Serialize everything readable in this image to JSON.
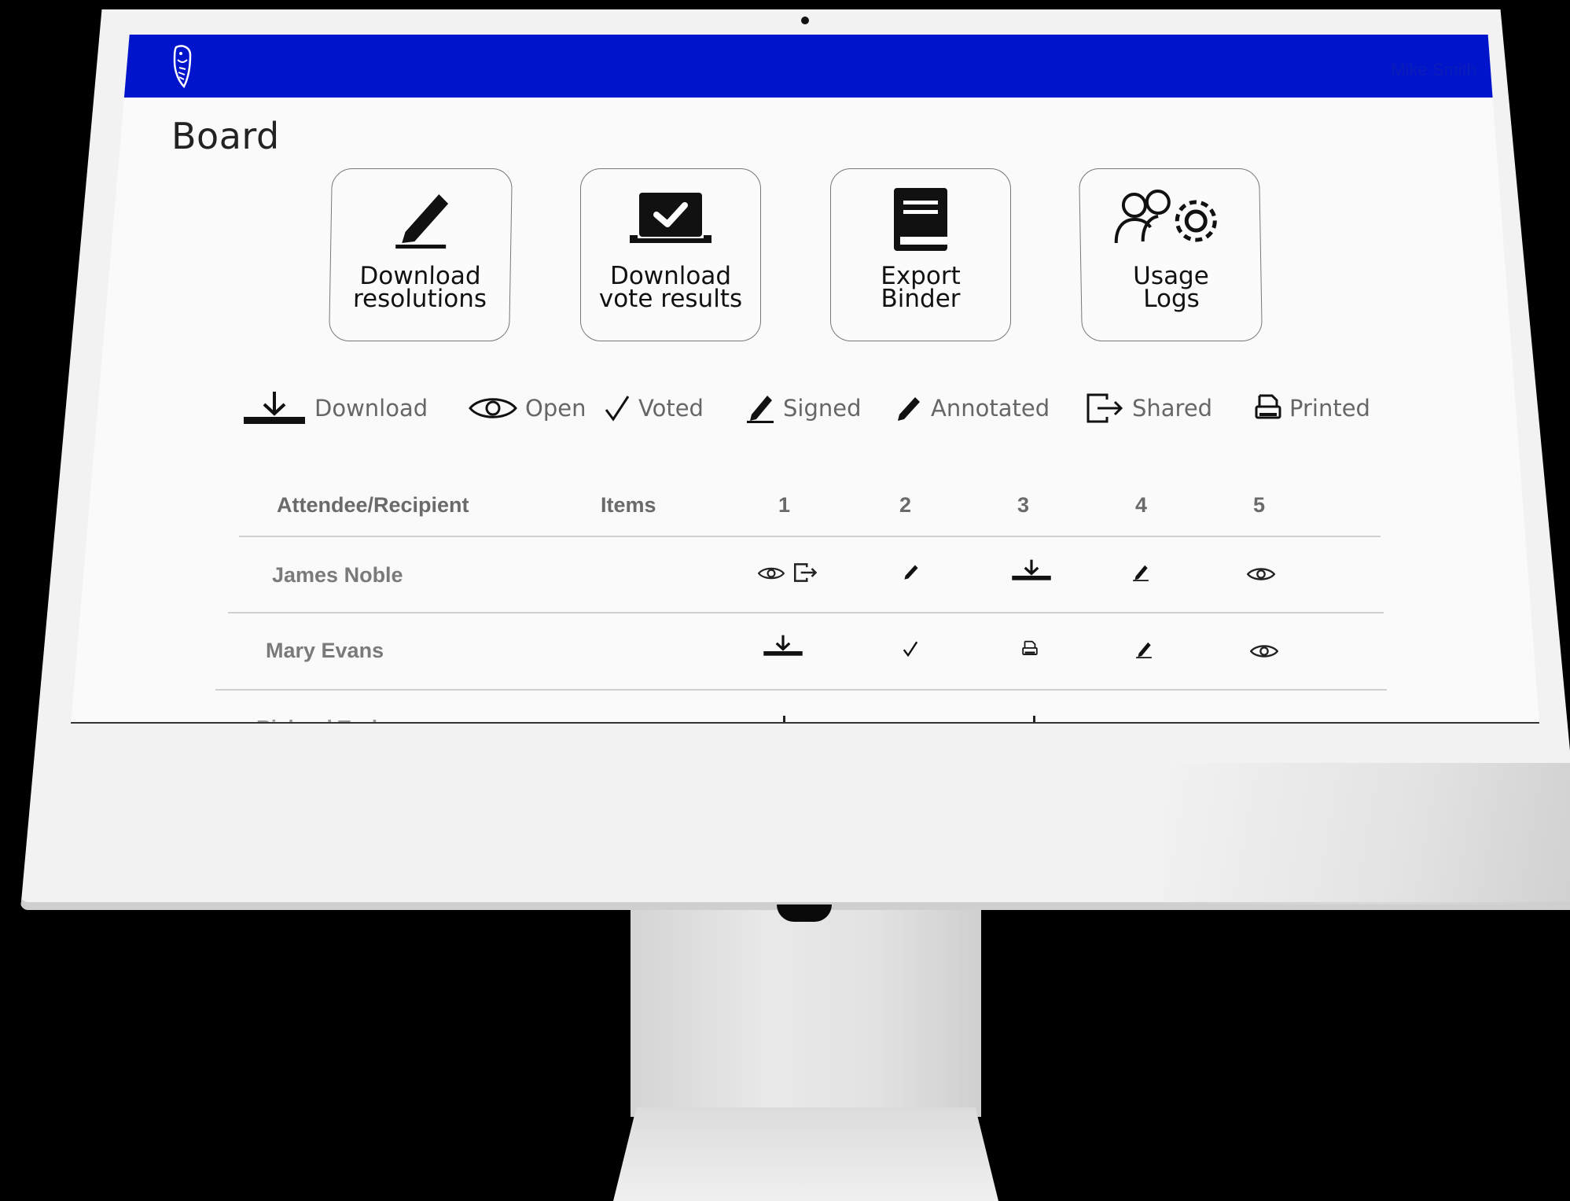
{
  "app": {
    "page_title": "Board",
    "topbar_user": "Mike Smith",
    "brand_color": "#0014cc"
  },
  "actions": [
    {
      "label": "Download\nresolutions",
      "icon": "pen-icon"
    },
    {
      "label": "Download\nvote results",
      "icon": "laptop-check-icon"
    },
    {
      "label": "Export\nBinder",
      "icon": "binder-icon"
    },
    {
      "label": "Usage\nLogs",
      "icon": "users-gear-icon"
    }
  ],
  "legend": [
    {
      "label": "Download",
      "icon": "download-icon"
    },
    {
      "label": "Open",
      "icon": "eye-icon"
    },
    {
      "label": "Voted",
      "icon": "check-icon"
    },
    {
      "label": "Signed",
      "icon": "sign-icon"
    },
    {
      "label": "Annotated",
      "icon": "pencil-icon"
    },
    {
      "label": "Shared",
      "icon": "share-icon"
    },
    {
      "label": "Printed",
      "icon": "printer-icon"
    }
  ],
  "table": {
    "headers": [
      "Attendee/Recipient",
      "Items",
      "1",
      "2",
      "3",
      "4",
      "5"
    ],
    "rows": [
      {
        "name": "James Noble",
        "cells": [
          [
            "eye-icon",
            "share-icon"
          ],
          [
            "pencil-icon"
          ],
          [
            "download-icon"
          ],
          [
            "sign-icon"
          ],
          [
            "eye-icon"
          ]
        ]
      },
      {
        "name": "Mary Evans",
        "cells": [
          [
            "download-icon"
          ],
          [
            "check-icon"
          ],
          [
            "printer-icon"
          ],
          [
            "sign-icon"
          ],
          [
            "eye-icon"
          ]
        ]
      }
    ],
    "partial_row_name": "Richard Taylor"
  }
}
